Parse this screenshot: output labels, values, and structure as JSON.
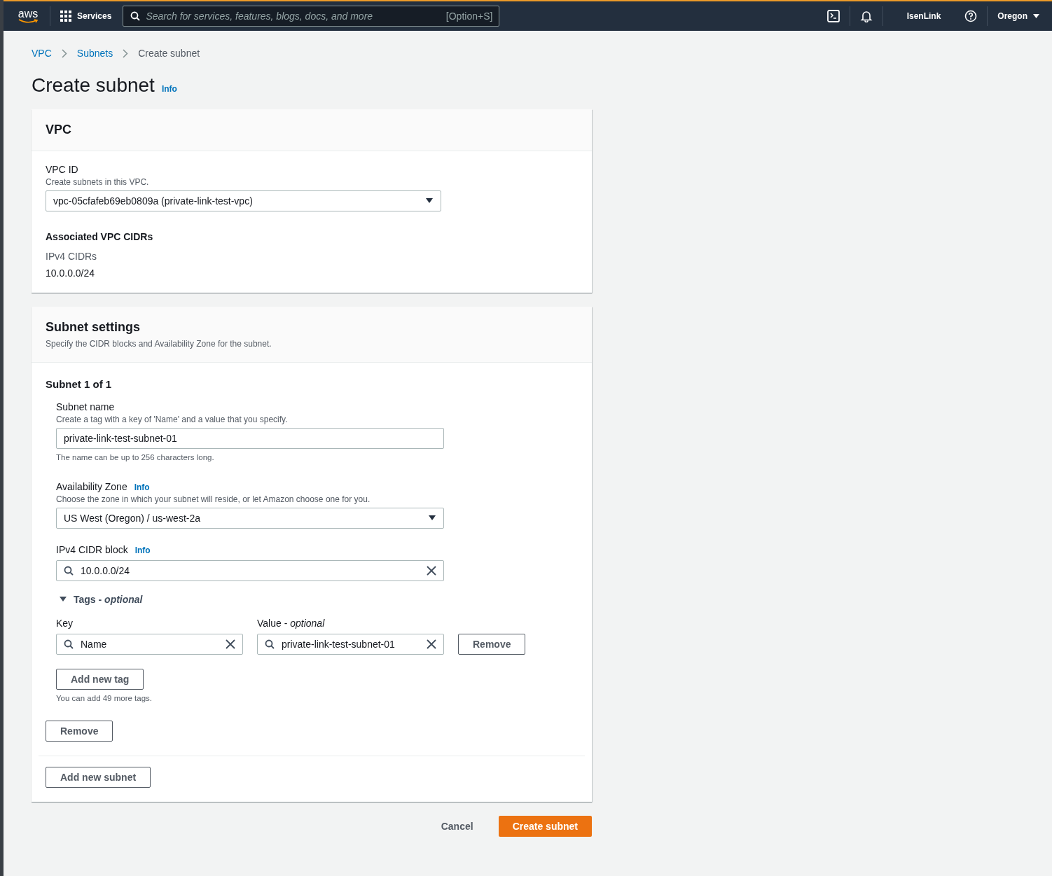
{
  "top_nav": {
    "logo": "aws",
    "services": "Services",
    "search_placeholder": "Search for services, features, blogs, docs, and more",
    "search_shortcut": "[Option+S]",
    "account": "IsenLink",
    "region": "Oregon"
  },
  "breadcrumbs": [
    {
      "label": "VPC",
      "link": true
    },
    {
      "label": "Subnets",
      "link": true
    },
    {
      "label": "Create subnet",
      "link": false
    }
  ],
  "page_title": "Create subnet",
  "page_info": "Info",
  "vpc_panel": {
    "title": "VPC",
    "vpc_id_label": "VPC ID",
    "vpc_id_hint": "Create subnets in this VPC.",
    "vpc_id_value": "vpc-05cfafeb69eb0809a (private-link-test-vpc)",
    "cidrs_heading": "Associated VPC CIDRs",
    "ipv4_label": "IPv4 CIDRs",
    "ipv4_value": "10.0.0.0/24"
  },
  "subnet_settings": {
    "title": "Subnet settings",
    "description": "Specify the CIDR blocks and Availability Zone for the subnet.",
    "subnets": [
      {
        "heading": "Subnet 1 of 1",
        "name_label": "Subnet name",
        "name_hint": "Create a tag with a key of 'Name' and a value that you specify.",
        "name_value": "private-link-test-subnet-01",
        "name_constraint": "The name can be up to 256 characters long.",
        "az_label": "Availability Zone",
        "az_info": "Info",
        "az_hint": "Choose the zone in which your subnet will reside, or let Amazon choose one for you.",
        "az_value": "US West (Oregon) / us-west-2a",
        "cidr_label": "IPv4 CIDR block",
        "cidr_info": "Info",
        "cidr_value": "10.0.0.0/24",
        "tags": {
          "label": "Tags - *optional*",
          "expanded": true,
          "key_label": "Key",
          "value_label": "Value - *optional*",
          "items": [
            {
              "key": "Name",
              "value": "private-link-test-subnet-01",
              "remove": "Remove"
            }
          ],
          "add_button": "Add new tag",
          "limit_text": "You can add 49 more tags."
        },
        "remove_button": "Remove"
      }
    ],
    "add_subnet_button": "Add new subnet"
  },
  "footer": {
    "cancel": "Cancel",
    "submit": "Create subnet"
  }
}
